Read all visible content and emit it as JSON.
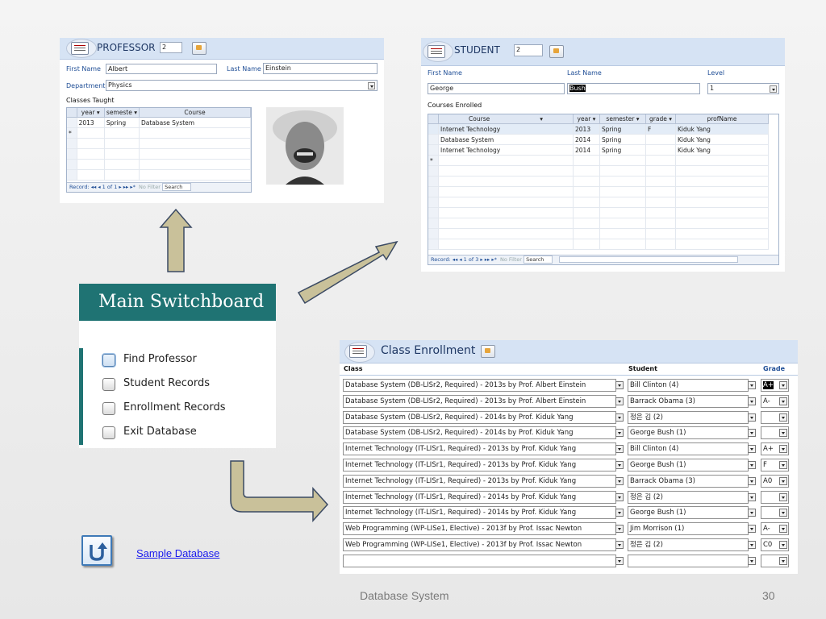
{
  "professor_form": {
    "title": "PROFESSOR",
    "id_value": "2",
    "first_name_label": "First Name",
    "first_name_value": "Albert",
    "last_name_label": "Last Name",
    "last_name_value": "Einstein",
    "department_label": "Department",
    "department_value": "Physics",
    "classes_label": "Classes Taught",
    "grid_headers": [
      "year",
      "semeste",
      "Course"
    ],
    "grid_rows": [
      [
        "2013",
        "Spring",
        "Database System"
      ]
    ],
    "new_row_marker": "*",
    "record_label": "Record:",
    "record_position": "1 of 1",
    "no_filter": "No Filter",
    "search": "Search",
    "photo_icon": "portrait-photo"
  },
  "student_form": {
    "title": "STUDENT",
    "id_value": "2",
    "first_name_label": "First Name",
    "first_name_value": "George",
    "last_name_label": "Last Name",
    "last_name_value": "Bush",
    "level_label": "Level",
    "level_value": "1",
    "courses_label": "Courses Enrolled",
    "grid_headers": [
      "Course",
      "year",
      "semester",
      "grade",
      "profName"
    ],
    "grid_rows": [
      [
        "Internet Technology",
        "2013",
        "Spring",
        "F",
        "Kiduk Yang"
      ],
      [
        "Database System",
        "2014",
        "Spring",
        "",
        "Kiduk Yang"
      ],
      [
        "Internet Technology",
        "2014",
        "Spring",
        "",
        "Kiduk Yang"
      ]
    ],
    "new_row_marker": "*",
    "record_label": "Record:",
    "record_position": "1 of 3",
    "no_filter": "No Filter",
    "search": "Search"
  },
  "switchboard": {
    "title": "Main Switchboard",
    "items": [
      "Find Professor",
      "Student Records",
      "Enrollment Records",
      "Exit Database"
    ]
  },
  "enrollment_form": {
    "title": "Class Enrollment",
    "col_class": "Class",
    "col_student": "Student",
    "col_grade": "Grade",
    "rows": [
      {
        "class": "Database System (DB-LISr2, Required) - 2013s by Prof. Albert Einstein",
        "student": "Bill Clinton (4)",
        "grade": "A+"
      },
      {
        "class": "Database System (DB-LISr2, Required) - 2013s by Prof. Albert Einstein",
        "student": "Barrack Obama (3)",
        "grade": "A-"
      },
      {
        "class": "Database System (DB-LISr2, Required) - 2014s by Prof. Kiduk Yang",
        "student": "정은 김 (2)",
        "grade": ""
      },
      {
        "class": "Database System (DB-LISr2, Required) - 2014s by Prof. Kiduk Yang",
        "student": "George Bush (1)",
        "grade": ""
      },
      {
        "class": "Internet Technology (IT-LISr1, Required) - 2013s by Prof. Kiduk Yang",
        "student": "Bill Clinton (4)",
        "grade": "A+"
      },
      {
        "class": "Internet Technology (IT-LISr1, Required) - 2013s by Prof. Kiduk Yang",
        "student": "George Bush (1)",
        "grade": "F"
      },
      {
        "class": "Internet Technology (IT-LISr1, Required) - 2013s by Prof. Kiduk Yang",
        "student": "Barrack Obama (3)",
        "grade": "A0"
      },
      {
        "class": "Internet Technology (IT-LISr1, Required) - 2014s by Prof. Kiduk Yang",
        "student": "정은 김 (2)",
        "grade": ""
      },
      {
        "class": "Internet Technology (IT-LISr1, Required) - 2014s by Prof. Kiduk Yang",
        "student": "George Bush (1)",
        "grade": ""
      },
      {
        "class": "Web Programming (WP-LISe1, Elective) - 2013f by Prof. Issac Newton",
        "student": "Jim Morrison (1)",
        "grade": "A-"
      },
      {
        "class": "Web Programming (WP-LISe1, Elective) - 2013f by Prof. Issac Newton",
        "student": "정은 김 (2)",
        "grade": "C0"
      },
      {
        "class": "",
        "student": "",
        "grade": ""
      }
    ]
  },
  "footer": {
    "link_text": "Sample Database",
    "center_text": "Database System",
    "page_number": "30",
    "return_icon": "return-arrow-icon"
  },
  "colors": {
    "switchboard_teal": "#1f7373",
    "arrow_fill": "#c9c19a",
    "arrow_stroke": "#3b4a63",
    "header_blue": "#d6e3f4"
  }
}
